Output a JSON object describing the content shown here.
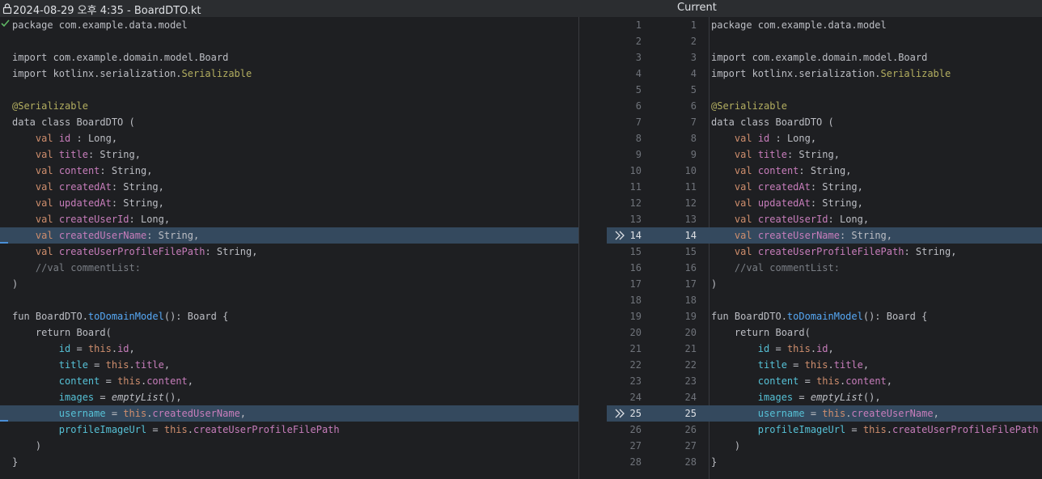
{
  "header": {
    "left_title": "2024-08-29 오후 4:35 - BoardDTO.kt",
    "right_title": "Current"
  },
  "left_lines": [
    [
      {
        "t": "package com.example.data.model"
      }
    ],
    [],
    [
      {
        "t": "import com.example.domain.model.Board"
      }
    ],
    [
      {
        "t": "import kotlinx.serialization."
      },
      {
        "t": "Serializable",
        "c": "ann"
      }
    ],
    [],
    [
      {
        "t": "@Serializable",
        "c": "ann"
      }
    ],
    [
      {
        "t": "data class BoardDTO ("
      }
    ],
    [
      {
        "t": "    "
      },
      {
        "t": "val",
        "c": "kw"
      },
      {
        "t": " "
      },
      {
        "t": "id",
        "c": "prop"
      },
      {
        "t": " : Long,"
      }
    ],
    [
      {
        "t": "    "
      },
      {
        "t": "val",
        "c": "kw"
      },
      {
        "t": " "
      },
      {
        "t": "title",
        "c": "prop"
      },
      {
        "t": ": String,"
      }
    ],
    [
      {
        "t": "    "
      },
      {
        "t": "val",
        "c": "kw"
      },
      {
        "t": " "
      },
      {
        "t": "content",
        "c": "prop"
      },
      {
        "t": ": String,"
      }
    ],
    [
      {
        "t": "    "
      },
      {
        "t": "val",
        "c": "kw"
      },
      {
        "t": " "
      },
      {
        "t": "createdAt",
        "c": "prop"
      },
      {
        "t": ": String,"
      }
    ],
    [
      {
        "t": "    "
      },
      {
        "t": "val",
        "c": "kw"
      },
      {
        "t": " "
      },
      {
        "t": "updatedAt",
        "c": "prop"
      },
      {
        "t": ": String,"
      }
    ],
    [
      {
        "t": "    "
      },
      {
        "t": "val",
        "c": "kw"
      },
      {
        "t": " "
      },
      {
        "t": "createUserId",
        "c": "prop"
      },
      {
        "t": ": Long,"
      }
    ],
    [
      {
        "t": "    "
      },
      {
        "t": "val",
        "c": "kw"
      },
      {
        "t": " "
      },
      {
        "t": "createdUserName",
        "c": "prop"
      },
      {
        "t": ": String,"
      }
    ],
    [
      {
        "t": "    "
      },
      {
        "t": "val",
        "c": "kw"
      },
      {
        "t": " "
      },
      {
        "t": "createUserProfileFilePath",
        "c": "prop"
      },
      {
        "t": ": String,"
      }
    ],
    [
      {
        "t": "    //val commentList:",
        "c": "cmt"
      }
    ],
    [
      {
        "t": ")"
      }
    ],
    [],
    [
      {
        "t": "fun BoardDTO."
      },
      {
        "t": "toDomainModel",
        "c": "fn"
      },
      {
        "t": "(): Board {"
      }
    ],
    [
      {
        "t": "    return Board("
      }
    ],
    [
      {
        "t": "        "
      },
      {
        "t": "id",
        "c": "param"
      },
      {
        "t": " = "
      },
      {
        "t": "this",
        "c": "kw"
      },
      {
        "t": "."
      },
      {
        "t": "id",
        "c": "prop"
      },
      {
        "t": ","
      }
    ],
    [
      {
        "t": "        "
      },
      {
        "t": "title",
        "c": "param"
      },
      {
        "t": " = "
      },
      {
        "t": "this",
        "c": "kw"
      },
      {
        "t": "."
      },
      {
        "t": "title",
        "c": "prop"
      },
      {
        "t": ","
      }
    ],
    [
      {
        "t": "        "
      },
      {
        "t": "content",
        "c": "param"
      },
      {
        "t": " = "
      },
      {
        "t": "this",
        "c": "kw"
      },
      {
        "t": "."
      },
      {
        "t": "content",
        "c": "prop"
      },
      {
        "t": ","
      }
    ],
    [
      {
        "t": "        "
      },
      {
        "t": "images",
        "c": "param"
      },
      {
        "t": " = "
      },
      {
        "t": "emptyList",
        "c": "italic"
      },
      {
        "t": "(),"
      }
    ],
    [
      {
        "t": "        "
      },
      {
        "t": "username",
        "c": "param"
      },
      {
        "t": " = "
      },
      {
        "t": "this",
        "c": "kw"
      },
      {
        "t": "."
      },
      {
        "t": "createdUserName",
        "c": "prop"
      },
      {
        "t": ","
      }
    ],
    [
      {
        "t": "        "
      },
      {
        "t": "profileImageUrl",
        "c": "param"
      },
      {
        "t": " = "
      },
      {
        "t": "this",
        "c": "kw"
      },
      {
        "t": "."
      },
      {
        "t": "createUserProfileFilePath",
        "c": "prop"
      }
    ],
    [
      {
        "t": "    )"
      }
    ],
    [
      {
        "t": "}"
      }
    ]
  ],
  "right_lines": [
    [
      {
        "t": "package com.example.data.model"
      }
    ],
    [],
    [
      {
        "t": "import com.example.domain.model.Board"
      }
    ],
    [
      {
        "t": "import kotlinx.serialization."
      },
      {
        "t": "Serializable",
        "c": "ann"
      }
    ],
    [],
    [
      {
        "t": "@Serializable",
        "c": "ann"
      }
    ],
    [
      {
        "t": "data class BoardDTO ("
      }
    ],
    [
      {
        "t": "    "
      },
      {
        "t": "val",
        "c": "kw"
      },
      {
        "t": " "
      },
      {
        "t": "id",
        "c": "prop"
      },
      {
        "t": " : Long,"
      }
    ],
    [
      {
        "t": "    "
      },
      {
        "t": "val",
        "c": "kw"
      },
      {
        "t": " "
      },
      {
        "t": "title",
        "c": "prop"
      },
      {
        "t": ": String,"
      }
    ],
    [
      {
        "t": "    "
      },
      {
        "t": "val",
        "c": "kw"
      },
      {
        "t": " "
      },
      {
        "t": "content",
        "c": "prop"
      },
      {
        "t": ": String,"
      }
    ],
    [
      {
        "t": "    "
      },
      {
        "t": "val",
        "c": "kw"
      },
      {
        "t": " "
      },
      {
        "t": "createdAt",
        "c": "prop"
      },
      {
        "t": ": String,"
      }
    ],
    [
      {
        "t": "    "
      },
      {
        "t": "val",
        "c": "kw"
      },
      {
        "t": " "
      },
      {
        "t": "updatedAt",
        "c": "prop"
      },
      {
        "t": ": String,"
      }
    ],
    [
      {
        "t": "    "
      },
      {
        "t": "val",
        "c": "kw"
      },
      {
        "t": " "
      },
      {
        "t": "createUserId",
        "c": "prop"
      },
      {
        "t": ": Long,"
      }
    ],
    [
      {
        "t": "    "
      },
      {
        "t": "val",
        "c": "kw"
      },
      {
        "t": " "
      },
      {
        "t": "createUserName",
        "c": "prop"
      },
      {
        "t": ": String,"
      }
    ],
    [
      {
        "t": "    "
      },
      {
        "t": "val",
        "c": "kw"
      },
      {
        "t": " "
      },
      {
        "t": "createUserProfileFilePath",
        "c": "prop"
      },
      {
        "t": ": String,"
      }
    ],
    [
      {
        "t": "    //val commentList:",
        "c": "cmt"
      }
    ],
    [
      {
        "t": ")"
      }
    ],
    [],
    [
      {
        "t": "fun BoardDTO."
      },
      {
        "t": "toDomainModel",
        "c": "fn"
      },
      {
        "t": "(): Board {"
      }
    ],
    [
      {
        "t": "    return Board("
      }
    ],
    [
      {
        "t": "        "
      },
      {
        "t": "id",
        "c": "param"
      },
      {
        "t": " = "
      },
      {
        "t": "this",
        "c": "kw"
      },
      {
        "t": "."
      },
      {
        "t": "id",
        "c": "prop"
      },
      {
        "t": ","
      }
    ],
    [
      {
        "t": "        "
      },
      {
        "t": "title",
        "c": "param"
      },
      {
        "t": " = "
      },
      {
        "t": "this",
        "c": "kw"
      },
      {
        "t": "."
      },
      {
        "t": "title",
        "c": "prop"
      },
      {
        "t": ","
      }
    ],
    [
      {
        "t": "        "
      },
      {
        "t": "content",
        "c": "param"
      },
      {
        "t": " = "
      },
      {
        "t": "this",
        "c": "kw"
      },
      {
        "t": "."
      },
      {
        "t": "content",
        "c": "prop"
      },
      {
        "t": ","
      }
    ],
    [
      {
        "t": "        "
      },
      {
        "t": "images",
        "c": "param"
      },
      {
        "t": " = "
      },
      {
        "t": "emptyList",
        "c": "italic"
      },
      {
        "t": "(),"
      }
    ],
    [
      {
        "t": "        "
      },
      {
        "t": "username",
        "c": "param"
      },
      {
        "t": " = "
      },
      {
        "t": "this",
        "c": "kw"
      },
      {
        "t": "."
      },
      {
        "t": "createUserName",
        "c": "prop"
      },
      {
        "t": ","
      }
    ],
    [
      {
        "t": "        "
      },
      {
        "t": "profileImageUrl",
        "c": "param"
      },
      {
        "t": " = "
      },
      {
        "t": "this",
        "c": "kw"
      },
      {
        "t": "."
      },
      {
        "t": "createUserProfileFilePath",
        "c": "prop"
      }
    ],
    [
      {
        "t": "    )"
      }
    ],
    [
      {
        "t": "}"
      }
    ]
  ],
  "gutter_numbers": [
    "1",
    "2",
    "3",
    "4",
    "5",
    "6",
    "7",
    "8",
    "9",
    "10",
    "11",
    "12",
    "13",
    "14",
    "15",
    "16",
    "17",
    "18",
    "19",
    "20",
    "21",
    "22",
    "23",
    "24",
    "25",
    "26",
    "27",
    "28"
  ],
  "changed_lines": [
    14,
    25
  ],
  "colors": {
    "keyword": "#cf8e6d",
    "property": "#c77dbb",
    "annotation": "#b3ae60",
    "function": "#56a8f5",
    "comment": "#7a7e85",
    "named_param": "#56c1d6",
    "change_highlight": "#34495e"
  },
  "icons": {
    "lock": "lock-icon",
    "check": "check-icon",
    "apply_arrow": "double-chevron-right-icon"
  }
}
